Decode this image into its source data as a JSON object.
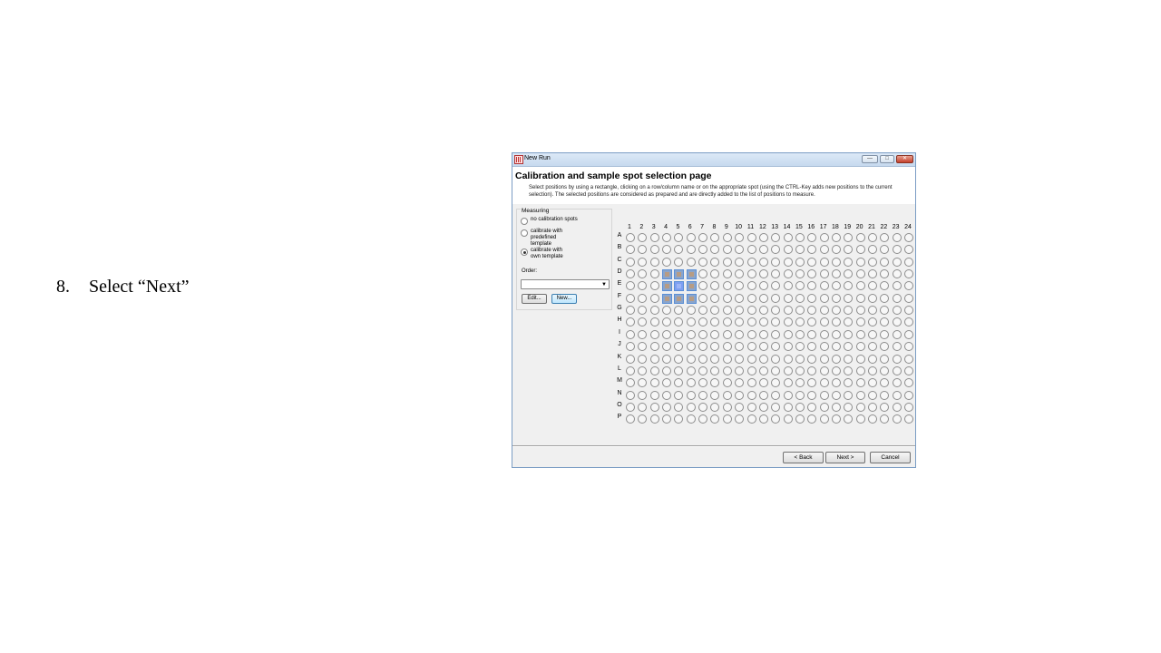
{
  "slide": {
    "step_number": "8.",
    "step_text": "Select “Next”"
  },
  "window": {
    "title": "New Run",
    "controls": {
      "minimize": "—",
      "maximize": "□",
      "close": "✕"
    }
  },
  "page": {
    "title": "Calibration and sample spot selection page",
    "description": "Select positions by using a rectangle, clicking on a row/column name or on the appropriate spot (using the CTRL-Key adds new positions to the current selection). The selected positions are considered as prepared and are directly added to the list of positions to measure."
  },
  "measuring": {
    "label": "Measuring",
    "options": [
      {
        "label": "no calibration spots",
        "checked": false
      },
      {
        "label": "calibrate  with predefined template",
        "checked": false
      },
      {
        "label": "calibrate  with own template",
        "checked": true
      }
    ],
    "order_label": "Order:",
    "order_value": "",
    "edit_button": "Edit...",
    "new_button": "New..."
  },
  "plate": {
    "columns": [
      "1",
      "2",
      "3",
      "4",
      "5",
      "6",
      "7",
      "8",
      "9",
      "10",
      "11",
      "12",
      "13",
      "14",
      "15",
      "16",
      "17",
      "18",
      "19",
      "20",
      "21",
      "22",
      "23",
      "24"
    ],
    "rows": [
      "A",
      "B",
      "C",
      "D",
      "E",
      "F",
      "G",
      "H",
      "I",
      "J",
      "K",
      "L",
      "M",
      "N",
      "O",
      "P"
    ],
    "selected_spots": [
      "D4",
      "D5",
      "D6",
      "E4",
      "E5",
      "E6",
      "F4",
      "F5",
      "F6"
    ],
    "center_spot": "E5"
  },
  "footer": {
    "back_button": "< Back",
    "next_button": "Next >",
    "cancel_button": "Cancel"
  }
}
